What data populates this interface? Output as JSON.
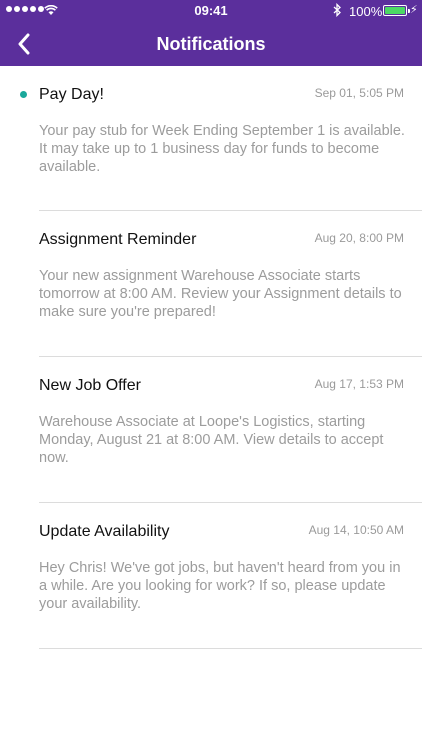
{
  "status_bar": {
    "time": "09:41",
    "battery_percent": "100%",
    "battery_level": 1.0
  },
  "nav": {
    "title": "Notifications",
    "back_icon": "chevron-left-icon"
  },
  "colors": {
    "header_bg": "#5b2f9c",
    "unread_dot": "#1aa89b",
    "battery_fill": "#4cd964"
  },
  "notifications": [
    {
      "title": "Pay Day!",
      "date": "Sep 01, 5:05 PM",
      "body": "Your pay stub for Week Ending September 1 is available. It may take up to 1 business day for funds to become available.",
      "unread": true
    },
    {
      "title": "Assignment Reminder",
      "date": "Aug 20, 8:00 PM",
      "body": "Your new assignment Warehouse Associate starts tomorrow at 8:00 AM.  Review your Assignment details to make sure you're prepared!",
      "unread": false
    },
    {
      "title": "New Job Offer",
      "date": "Aug 17, 1:53 PM",
      "body": "Warehouse Associate at Loope's Logistics, starting Monday, August 21 at 8:00 AM.  View details to accept now.",
      "unread": false
    },
    {
      "title": "Update Availability",
      "date": "Aug 14, 10:50 AM",
      "body": "Hey Chris!  We've got jobs, but haven't heard from you in a while.  Are you looking for work?  If so, please update your availability.",
      "unread": false
    }
  ]
}
